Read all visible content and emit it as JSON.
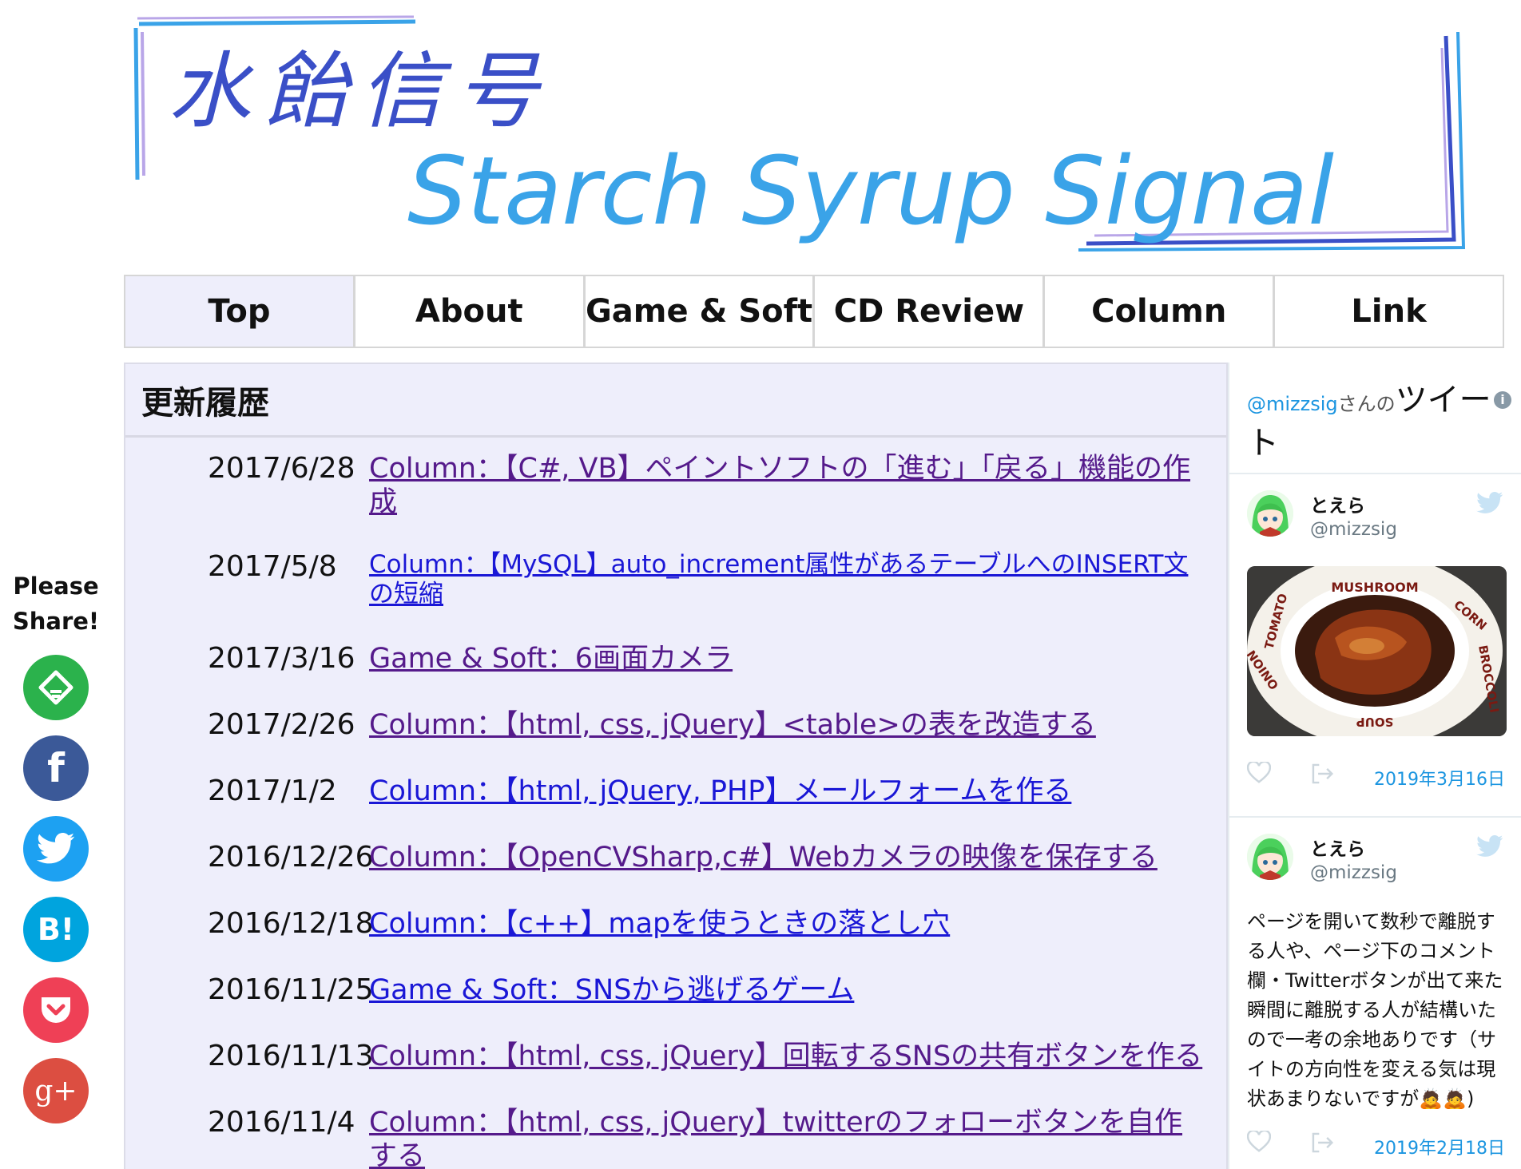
{
  "site": {
    "logo_text_jp": "水飴信号",
    "logo_text_en": "Starch Syrup Signal"
  },
  "nav": {
    "items": [
      {
        "label": "Top",
        "active": true
      },
      {
        "label": "About",
        "active": false
      },
      {
        "label": "Game & Soft",
        "active": false
      },
      {
        "label": "CD Review",
        "active": false
      },
      {
        "label": "Column",
        "active": false
      },
      {
        "label": "Link",
        "active": false
      }
    ]
  },
  "updates": {
    "heading": "更新履歴",
    "rows": [
      {
        "date": "2017/6/28",
        "link": "Column：【C#, VB】ペイントソフトの「進む」「戻る」機能の作成",
        "visited": true
      },
      {
        "date": "2017/5/8",
        "link": "Column：【MySQL】auto_increment属性があるテーブルへのINSERT文の短縮",
        "visited": false
      },
      {
        "date": "2017/3/16",
        "link": "Game & Soft：6画面カメラ",
        "visited": true
      },
      {
        "date": "2017/2/26",
        "link": "Column：【html, css, jQuery】<table>の表を改造する",
        "visited": true
      },
      {
        "date": "2017/1/2",
        "link": "Column：【html, jQuery, PHP】メールフォームを作る",
        "visited": false
      },
      {
        "date": "2016/12/26",
        "link": "Column：【OpenCVSharp,c#】Webカメラの映像を保存する",
        "visited": true
      },
      {
        "date": "2016/12/18",
        "link": "Column：【c++】mapを使うときの落とし穴",
        "visited": false
      },
      {
        "date": "2016/11/25",
        "link": "Game & Soft：SNSから逃げるゲーム",
        "visited": false
      },
      {
        "date": "2016/11/13",
        "link": "Column：【html, css, jQuery】回転するSNSの共有ボタンを作る",
        "visited": true
      },
      {
        "date": "2016/11/4",
        "link": "Column：【html, css, jQuery】twitterのフォローボタンを自作する",
        "visited": true
      }
    ]
  },
  "share": {
    "label_line1": "Please",
    "label_line2": "Share!",
    "buttons": [
      {
        "icon": "feedly-icon",
        "color": "#2bb24c"
      },
      {
        "icon": "facebook-icon",
        "color": "#3b5998",
        "glyph": "f"
      },
      {
        "icon": "twitter-icon",
        "color": "#1da1f2"
      },
      {
        "icon": "hatena-bookmark-icon",
        "color": "#00a4de",
        "glyph": "B!"
      },
      {
        "icon": "pocket-icon",
        "color": "#ef4056"
      },
      {
        "icon": "google-plus-icon",
        "color": "#dc4e41",
        "glyph": "g+"
      }
    ]
  },
  "twitter": {
    "header_handle": "@mizzsig",
    "header_suffix": "さんの",
    "header_title": "ツイート",
    "tweets": [
      {
        "name": "とえら",
        "user": "@mizzsig",
        "photo_labels": {
          "top": "MUSHROOM",
          "corn": "CORN",
          "broccoli": "BROCCOLI",
          "soup": "SOUP",
          "onion": "ONION",
          "tomato": "TOMATO"
        },
        "date": "2019年3月16日"
      },
      {
        "name": "とえら",
        "user": "@mizzsig",
        "text": "ページを開いて数秒で離脱する人や、ページ下のコメント欄・Twitterボタンが出て来た瞬間に離脱する人が結構いたので一考の余地ありです（サイトの方向性を変える気は現状あまりないですが🙇🙇)",
        "date": "2019年2月18日"
      }
    ]
  },
  "colors": {
    "nav_active_bg": "#eeeefb",
    "panel_bg": "#eeeefb",
    "link_visited": "#551a8b",
    "link_unvisited": "#1a17d6",
    "twitter_blue": "#1b95e0",
    "logo_blue": "#3aa3e8",
    "logo_navy": "#3a4fc7"
  }
}
